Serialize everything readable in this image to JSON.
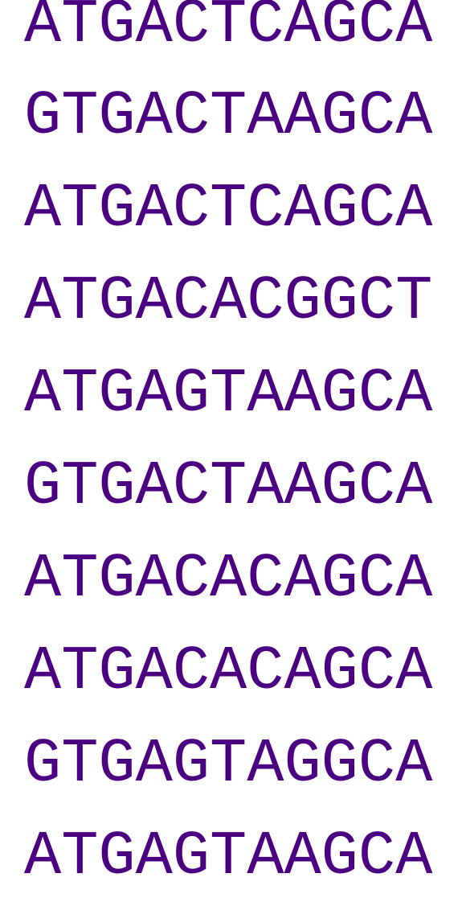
{
  "text_color": "#4B0082",
  "background_color": "#FFFFFF",
  "sequences": [
    "ATGACTCAGCA",
    "GTGACTAAGCA",
    "ATGACTCAGCA",
    "ATGACACGGCT",
    "ATGAGTAAGCA",
    "GTGACTAAGCA",
    "ATGACACAGCA",
    "ATGACACAGCA",
    "GTGAGTAGGCA",
    "ATGAGTAAGCA"
  ]
}
